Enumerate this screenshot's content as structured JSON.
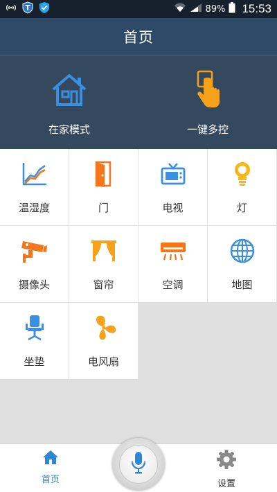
{
  "status_bar": {
    "battery": "89%",
    "time": "15:53",
    "icons": [
      "wifi-hotspot-icon",
      "shield-t-icon",
      "shield-check-icon",
      "wifi-icon",
      "signal-icon",
      "battery-icon"
    ]
  },
  "header": {
    "title": "首页"
  },
  "modes": [
    {
      "label": "在家模式",
      "icon": "house-icon",
      "color": "#3a8fe0"
    },
    {
      "label": "一键多控",
      "icon": "touch-finger-icon",
      "color": "#f5a11a"
    }
  ],
  "devices": [
    {
      "label": "温湿度",
      "icon": "chart-line-icon"
    },
    {
      "label": "门",
      "icon": "door-icon"
    },
    {
      "label": "电视",
      "icon": "tv-icon"
    },
    {
      "label": "灯",
      "icon": "bulb-icon"
    },
    {
      "label": "摄像头",
      "icon": "camera-icon"
    },
    {
      "label": "窗帘",
      "icon": "curtain-icon"
    },
    {
      "label": "空调",
      "icon": "air-conditioner-icon"
    },
    {
      "label": "地图",
      "icon": "globe-icon"
    },
    {
      "label": "坐垫",
      "icon": "chair-icon"
    },
    {
      "label": "电风扇",
      "icon": "fan-icon"
    }
  ],
  "bottom_bar": {
    "home_label": "首页",
    "settings_label": "设置",
    "accent": "#2f86d6"
  }
}
